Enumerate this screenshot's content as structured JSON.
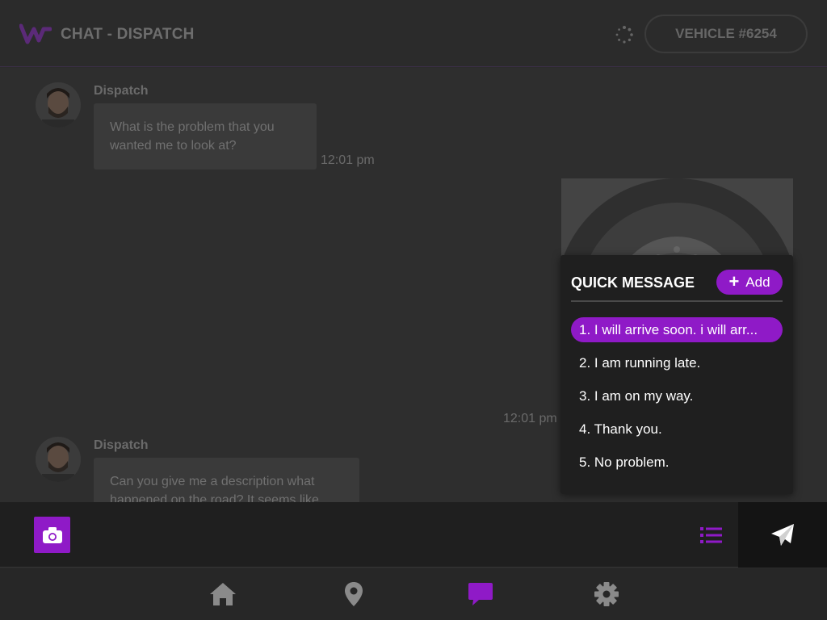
{
  "header": {
    "title": "CHAT - DISPATCH",
    "vehicle": "VEHICLE #6254",
    "logo_icon": "brand-logo-icon",
    "status_icon": "loading-spinner-icon"
  },
  "messages": [
    {
      "sender": "Dispatch",
      "text": "What is the problem that you wanted me to look at?",
      "time": "12:01 pm"
    },
    {
      "type": "photo",
      "description_icon": "tire-photo",
      "time": "12:01 pm"
    },
    {
      "sender": "Dispatch",
      "text": "Can you give me a description what happened on the road? It seems like"
    }
  ],
  "quick_message": {
    "title": "QUICK MESSAGE",
    "add_label": "Add",
    "items": [
      "1. I will arrive soon. i will arr...",
      "2. I am running late.",
      "3. I am on my way.",
      "4. Thank you.",
      "5. No problem."
    ],
    "selected_index": 0
  },
  "composer": {
    "camera_icon": "camera-icon",
    "list_icon": "list-icon",
    "send_icon": "send-icon"
  },
  "nav": {
    "items": [
      "home-icon",
      "location-pin-icon",
      "chat-icon",
      "settings-icon"
    ],
    "active": "chat-icon"
  },
  "colors": {
    "accent": "#8f1ac7",
    "background": "#2e2e2e",
    "panel": "#1f1f1f",
    "nav_inactive": "#8a8a8a"
  }
}
